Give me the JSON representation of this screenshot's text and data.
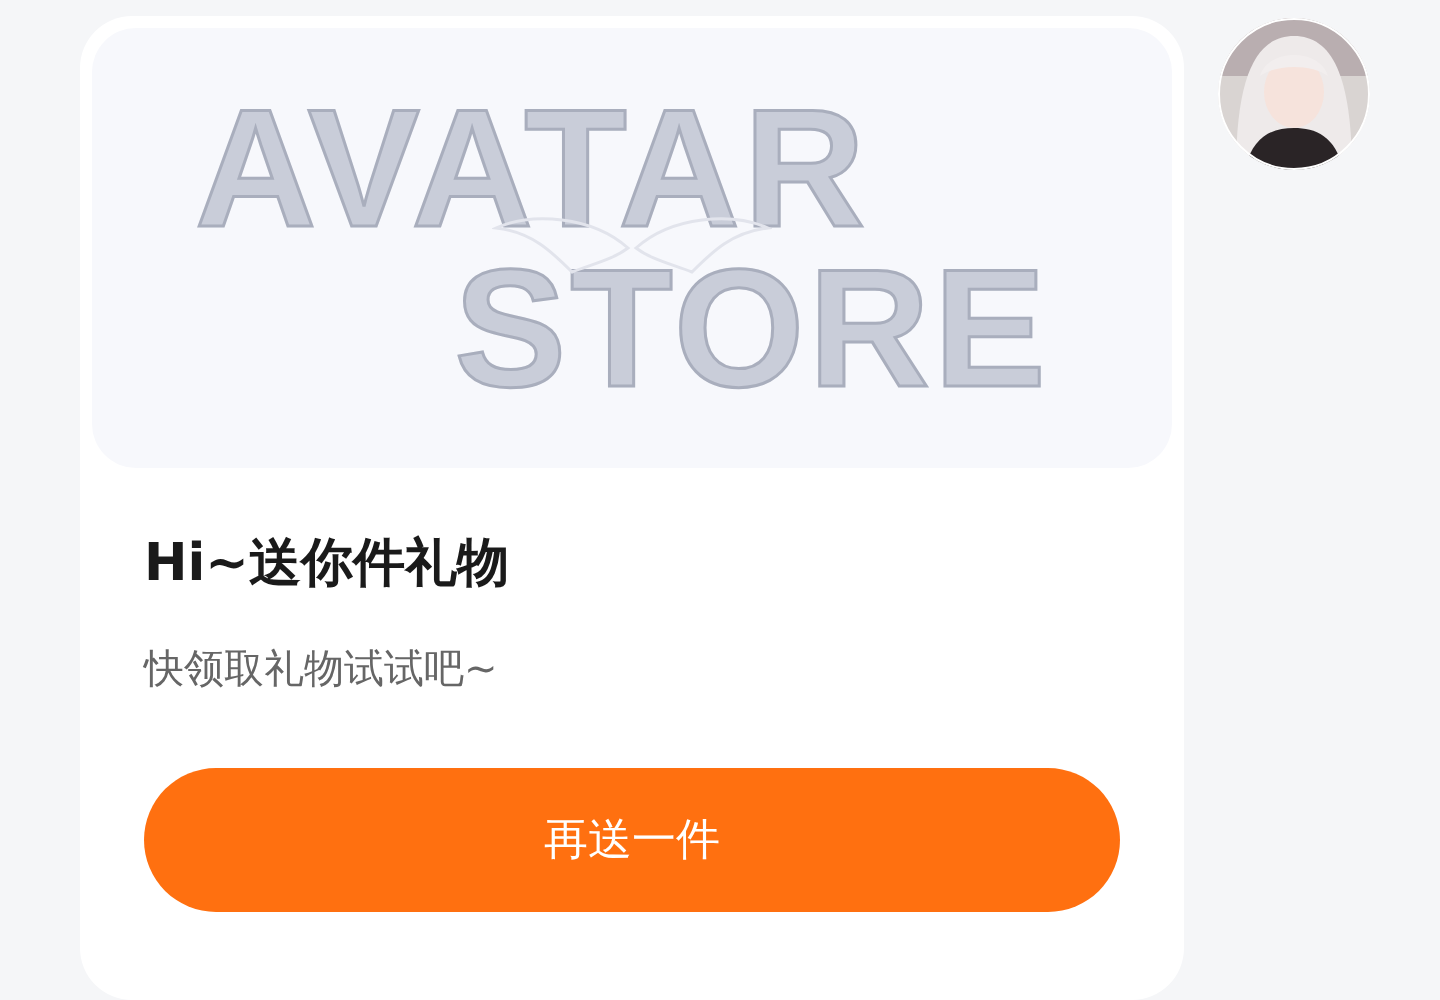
{
  "banner": {
    "line_1": "AVATAR",
    "line_2": "STORE"
  },
  "title": "Hi~送你件礼物",
  "subtitle": "快领取礼物试试吧~",
  "button": "再送一件"
}
